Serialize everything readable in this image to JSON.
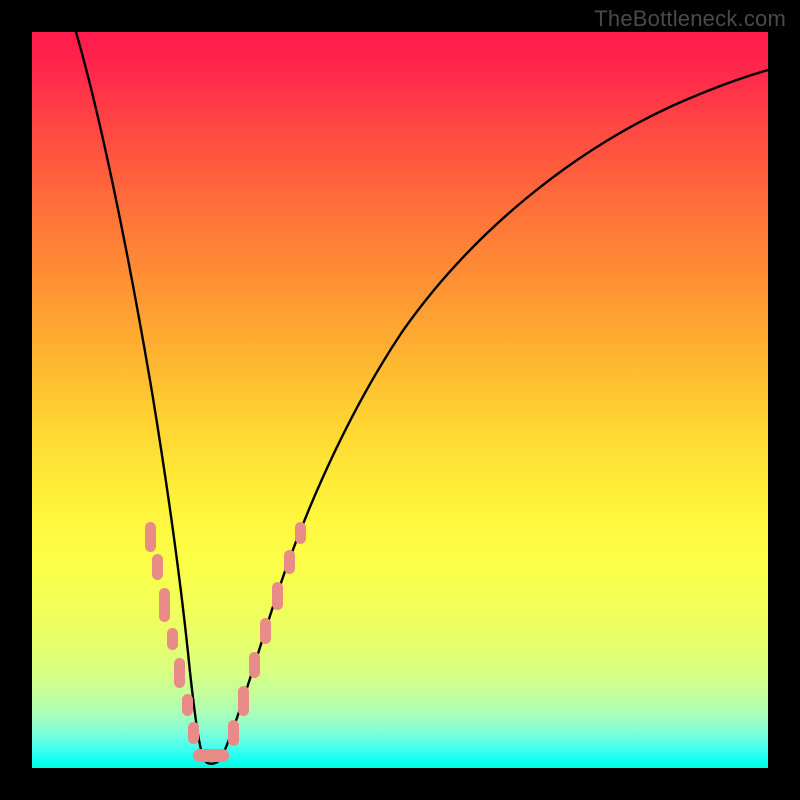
{
  "watermark": {
    "text": "TheBottleneck.com"
  },
  "chart_data": {
    "type": "line",
    "title": "",
    "xlabel": "",
    "ylabel": "",
    "xlim": [
      0,
      100
    ],
    "ylim": [
      0,
      100
    ],
    "grid": false,
    "legend": false,
    "description": "Bottleneck V-curve over red-to-green vertical gradient; minimum near x≈22.",
    "series": [
      {
        "name": "bottleneck-curve",
        "color": "#000000",
        "x": [
          6,
          8,
          10,
          12,
          14,
          16,
          18,
          20,
          21,
          22,
          23,
          24,
          25,
          27,
          30,
          34,
          40,
          48,
          58,
          70,
          84,
          100
        ],
        "y": [
          100,
          85,
          71,
          58,
          45,
          33,
          22,
          10,
          4,
          1,
          1,
          3,
          7,
          14,
          22,
          31,
          42,
          53,
          63,
          72,
          80,
          86
        ]
      }
    ],
    "markers": [
      {
        "name": "left-branch-dots",
        "color": "#e98b87",
        "shape": "rounded",
        "points": [
          {
            "x": 15.8,
            "y": 32.5
          },
          {
            "x": 16.6,
            "y": 28.0
          },
          {
            "x": 17.5,
            "y": 23.0
          },
          {
            "x": 18.3,
            "y": 18.0
          },
          {
            "x": 19.4,
            "y": 12.0
          },
          {
            "x": 20.2,
            "y": 8.0
          },
          {
            "x": 21.0,
            "y": 3.5
          }
        ]
      },
      {
        "name": "valley-dots",
        "color": "#e98b87",
        "shape": "rounded",
        "points": [
          {
            "x": 22.0,
            "y": 1.0
          },
          {
            "x": 23.2,
            "y": 1.0
          },
          {
            "x": 24.3,
            "y": 1.2
          }
        ]
      },
      {
        "name": "right-branch-dots",
        "color": "#e98b87",
        "shape": "rounded",
        "points": [
          {
            "x": 25.8,
            "y": 6.0
          },
          {
            "x": 27.5,
            "y": 12.0
          },
          {
            "x": 29.0,
            "y": 17.0
          },
          {
            "x": 30.8,
            "y": 22.0
          },
          {
            "x": 32.5,
            "y": 27.0
          },
          {
            "x": 34.0,
            "y": 31.0
          },
          {
            "x": 35.5,
            "y": 34.5
          }
        ]
      }
    ],
    "background_gradient": {
      "orientation": "vertical",
      "stops": [
        {
          "pos": 0.0,
          "color": "#ff1a4d"
        },
        {
          "pos": 0.5,
          "color": "#ffcf32"
        },
        {
          "pos": 0.78,
          "color": "#f2ff58"
        },
        {
          "pos": 0.95,
          "color": "#7cffd8"
        },
        {
          "pos": 1.0,
          "color": "#00ffd8"
        }
      ]
    }
  }
}
